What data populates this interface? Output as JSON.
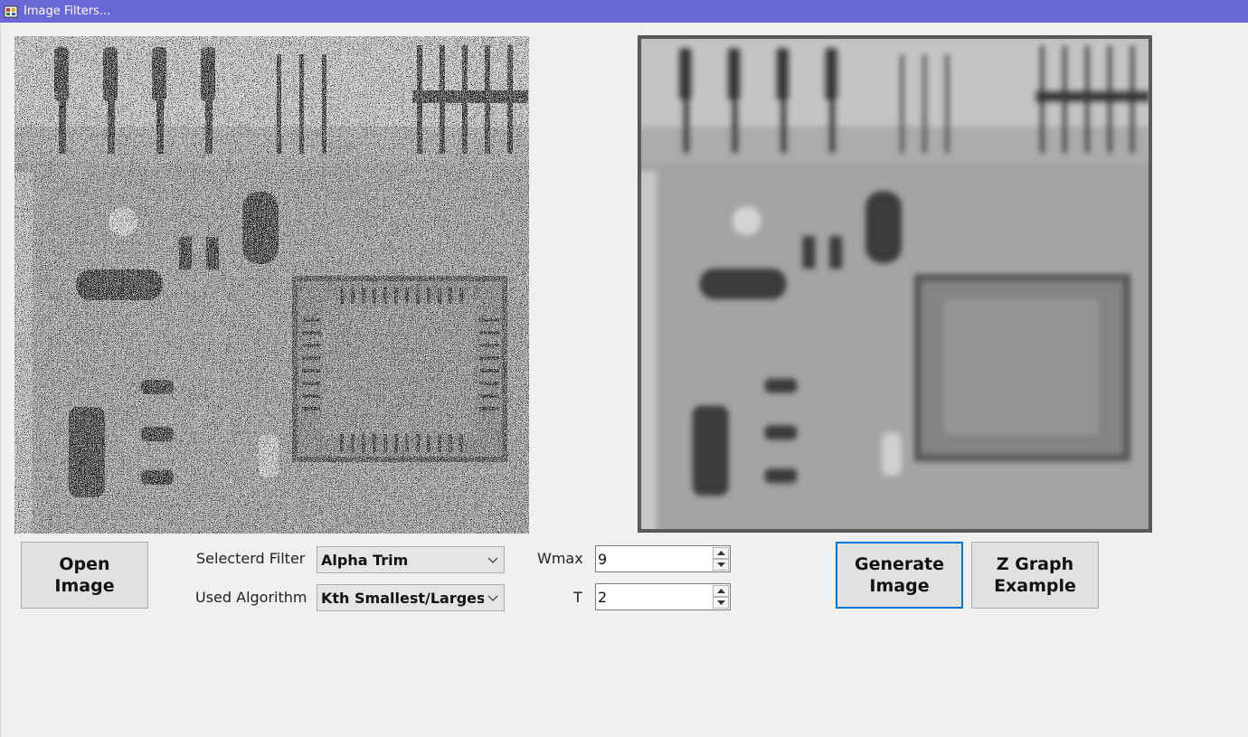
{
  "window": {
    "title": "Image Filters...",
    "icon": "app-icon"
  },
  "images": {
    "source": {
      "icon": "noisy-circuit-board-image"
    },
    "result": {
      "icon": "filtered-circuit-board-image"
    }
  },
  "buttons": {
    "open_image": "Open\nImage",
    "generate_image": "Generate\nImage",
    "z_graph_example": "Z Graph\nExample"
  },
  "controls": {
    "filter_label": "Selecterd Filter",
    "filter_value": "Alpha Trim",
    "algorithm_label": "Used Algorithm",
    "algorithm_value": "Kth Smallest/Largest",
    "wmax_label": "Wmax",
    "wmax_value": "9",
    "t_label": "T",
    "t_value": "2"
  },
  "colors": {
    "titlebar": "#6a67d6",
    "focus_border": "#0078d7",
    "background": "#f0f0f0"
  }
}
